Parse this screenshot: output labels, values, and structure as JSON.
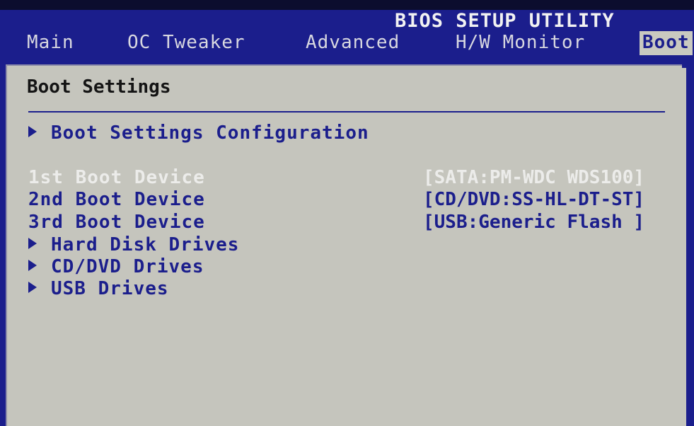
{
  "app": {
    "title": "BIOS SETUP UTILITY"
  },
  "tabs": [
    {
      "label": "Main"
    },
    {
      "label": "OC Tweaker"
    },
    {
      "label": "Advanced"
    },
    {
      "label": "H/W Monitor"
    },
    {
      "label": "Boot"
    }
  ],
  "section": {
    "title": "Boot Settings"
  },
  "menu": {
    "config": "Boot Settings Configuration",
    "boot_devices": [
      {
        "label": "1st Boot Device",
        "value": "[SATA:PM-WDC WDS100]"
      },
      {
        "label": "2nd Boot Device",
        "value": "[CD/DVD:SS-HL-DT-ST]"
      },
      {
        "label": "3rd Boot Device",
        "value": "[USB:Generic Flash ]"
      }
    ],
    "submenus": [
      {
        "label": "Hard Disk Drives"
      },
      {
        "label": "CD/DVD Drives"
      },
      {
        "label": "USB Drives"
      }
    ]
  },
  "colors": {
    "background": "#1b1e8c",
    "panel": "#c5c5bd",
    "text_accent": "#1b1e8c",
    "highlight_text": "#ececea"
  },
  "icons": {
    "submenu_marker": "triangle-right-icon"
  }
}
